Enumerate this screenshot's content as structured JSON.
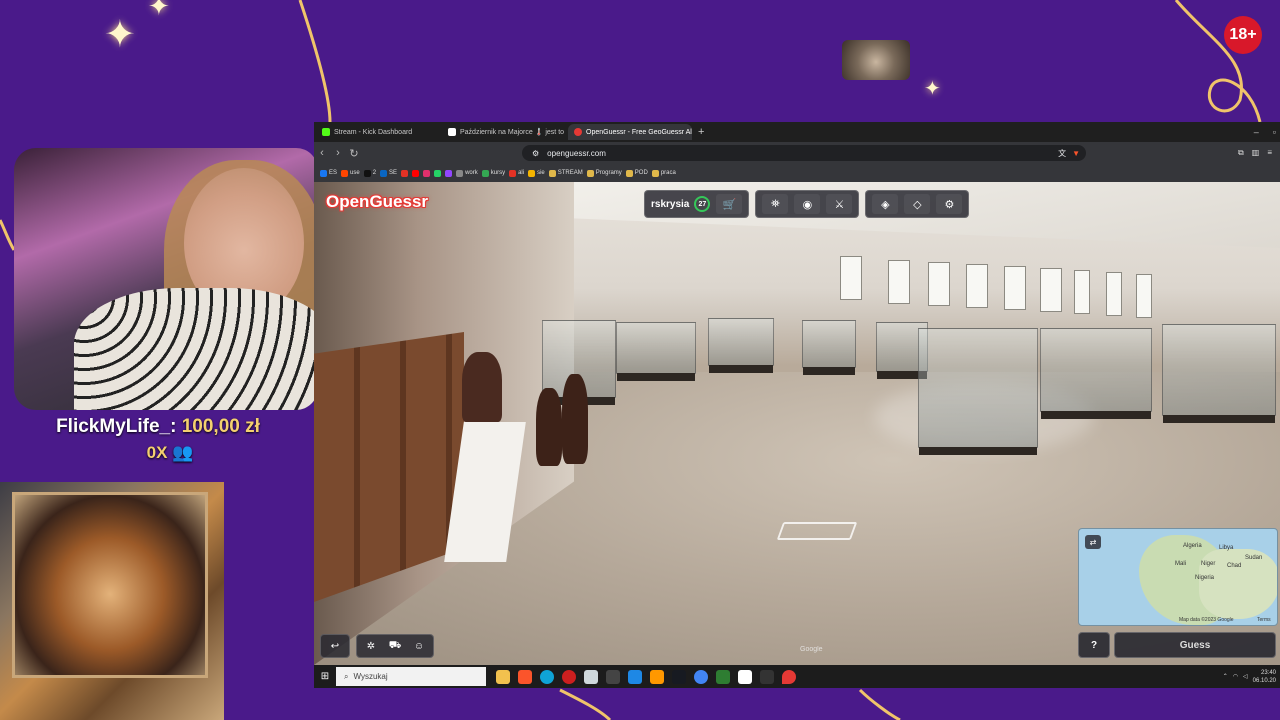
{
  "overlay": {
    "age_badge": "18+",
    "donation": {
      "user": "FlickMyLife_:",
      "amount": "100,00 zł"
    },
    "viewers": "0X"
  },
  "browser": {
    "tabs": [
      {
        "title": "Stream - Kick Dashboard",
        "favicon_color": "#53fc18",
        "active": false
      },
      {
        "title": "Październik na Majorce 🌡️ jest to na",
        "favicon_color": "#ffffff",
        "active": false
      },
      {
        "title": "OpenGuessr - Free GeoGuessr Al",
        "favicon_color": "#e53935",
        "active": true
      }
    ],
    "new_tab_label": "+",
    "url": "openguessr.com",
    "bookmarks": [
      {
        "label": "ES",
        "color": "#1877f2"
      },
      {
        "label": "use",
        "color": "#ff4500"
      },
      {
        "label": "2",
        "color": "#111111"
      },
      {
        "label": "SE",
        "color": "#0a66c2"
      },
      {
        "label": "work",
        "color": "#777777"
      },
      {
        "label": "kursy",
        "color": "#34a853"
      },
      {
        "label": "ali",
        "color": "#e43225"
      },
      {
        "label": "sie",
        "color": "#f4b400"
      },
      {
        "label": "STREAM",
        "color": "#e0b84a"
      },
      {
        "label": "Programy",
        "color": "#e0b84a"
      },
      {
        "label": "POD",
        "color": "#e0b84a"
      },
      {
        "label": "praca",
        "color": "#e0b84a"
      }
    ]
  },
  "game": {
    "logo": "OpenGuessr",
    "username": "rskrysia",
    "level": "27",
    "watermark": "Google",
    "minimap": {
      "labels": [
        "Algeria",
        "Libya",
        "Mali",
        "Niger",
        "Chad",
        "Nigeria",
        "Sudan"
      ],
      "attribution": "Map data ©2023 Google",
      "terms": "Terms"
    },
    "help_label": "?",
    "guess_label": "Guess"
  },
  "taskbar": {
    "search_placeholder": "Wyszukaj",
    "time": "23:40",
    "date": "06.10.20"
  }
}
